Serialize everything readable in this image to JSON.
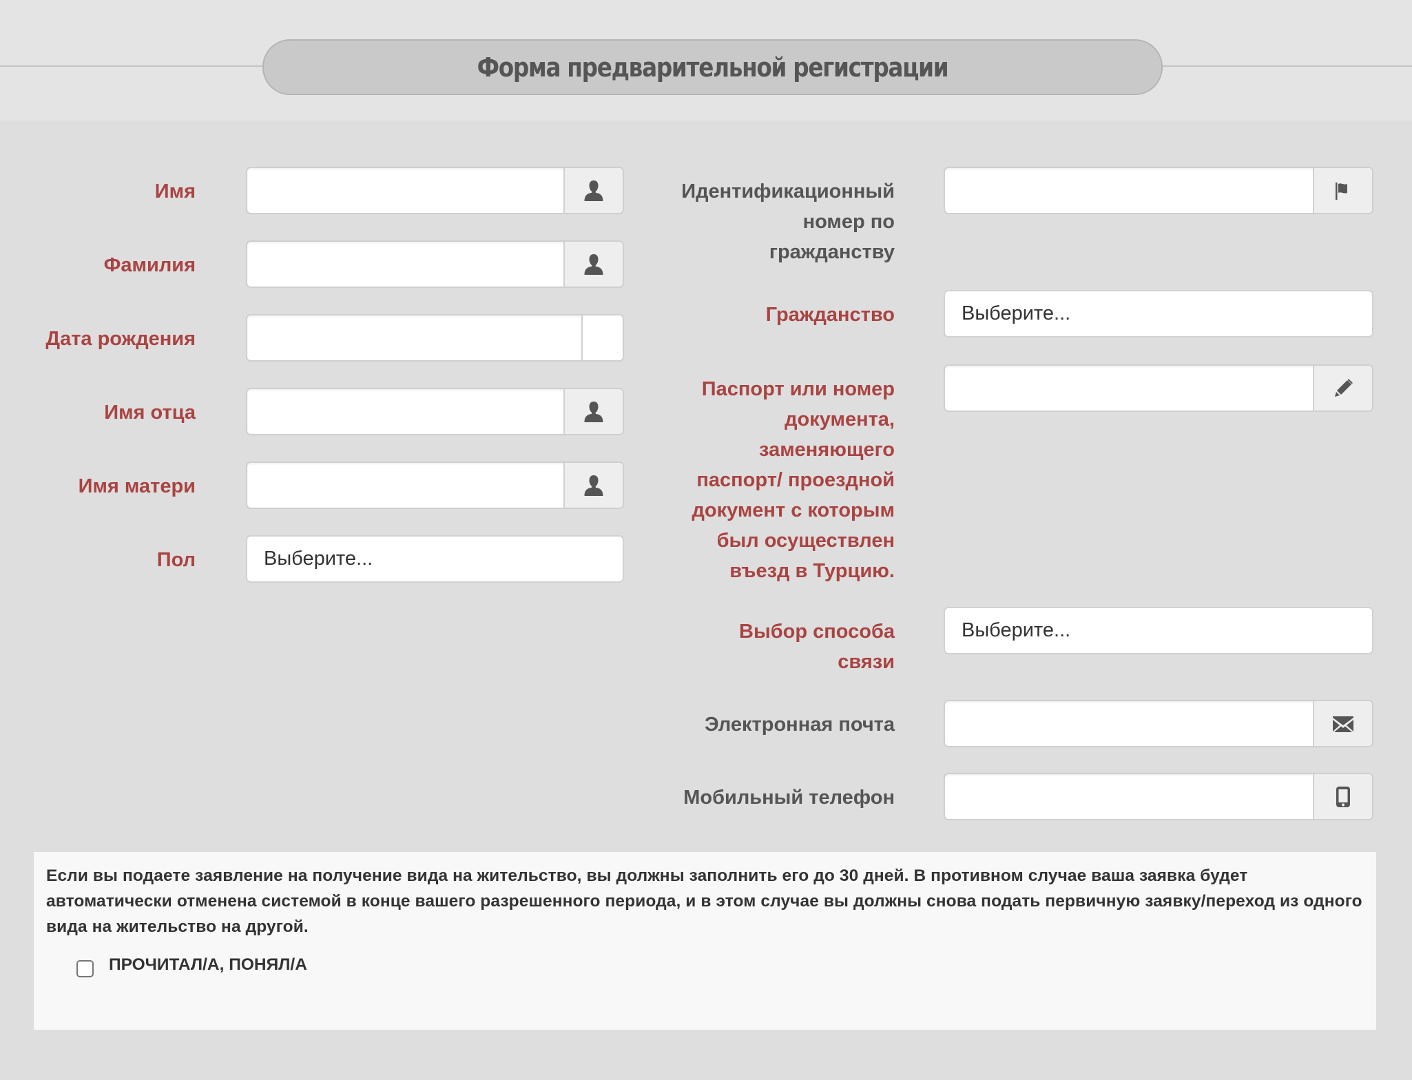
{
  "header": {
    "title": "Форма предварительной регистрации"
  },
  "left_fields": {
    "first_name": {
      "label": "Имя",
      "value": "",
      "icon": "user-icon"
    },
    "last_name": {
      "label": "Фамилия",
      "value": "",
      "icon": "user-icon"
    },
    "birth_date": {
      "label": "Дата рождения",
      "value": ""
    },
    "father_name": {
      "label": "Имя отца",
      "value": "",
      "icon": "user-icon"
    },
    "mother_name": {
      "label": "Имя матери",
      "value": "",
      "icon": "user-icon"
    },
    "gender": {
      "label": "Пол",
      "selected": "Выберите..."
    }
  },
  "right_fields": {
    "citizen_id": {
      "label_lines": [
        "Идентификационный",
        "номер по",
        "гражданству"
      ],
      "value": "",
      "icon": "flag-icon"
    },
    "citizenship": {
      "label": "Гражданство",
      "selected": "Выберите..."
    },
    "passport": {
      "label_lines": [
        "Паспорт или номер",
        "документа,",
        "заменяющего",
        "паспорт/ проездной",
        "документ с которым",
        "был осуществлен",
        "въезд в Турцию."
      ],
      "value": "",
      "icon": "pencil-icon"
    },
    "contact_method": {
      "label_lines": [
        "Выбор способа",
        "связи"
      ],
      "selected": "Выберите..."
    },
    "email": {
      "label": "Электронная почта",
      "value": "",
      "icon": "envelope-icon"
    },
    "mobile": {
      "label": "Мобильный телефон",
      "value": "",
      "icon": "mobile-phone-icon"
    }
  },
  "notice": {
    "text": "Если вы подаете заявление на получение вида на жительство, вы должны заполнить его до 30 дней. В противном случае ваша заявка будет автоматически отменена системой в конце вашего разрешенного периода, и в этом случае вы должны снова подать первичную заявку/переход из одного вида на жительство на другой.",
    "ack_label": "ПРОЧИТАЛ/А, ПОНЯЛ/А",
    "ack_checked": false
  },
  "colors": {
    "required_label": "#a94442",
    "optional_label": "#555555",
    "page_bg": "#dedede",
    "header_bg": "#e4e4e4",
    "title_pill_bg": "#c9c9c9",
    "notice_bg": "#f8f8f8",
    "icon": "#555555"
  }
}
